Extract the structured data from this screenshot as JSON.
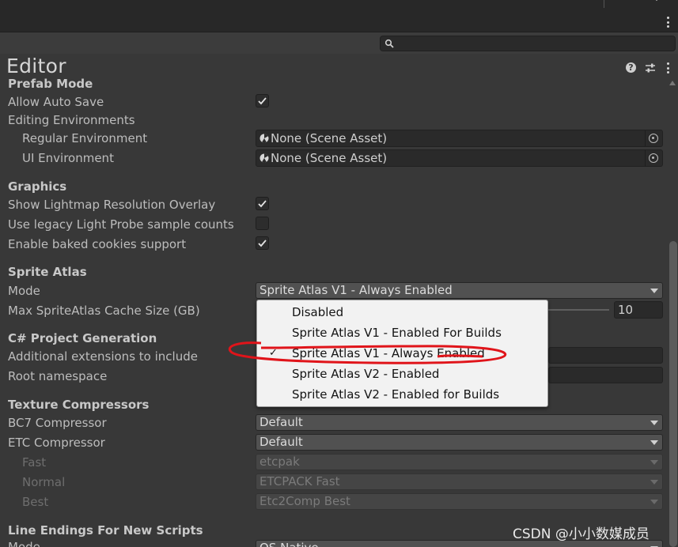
{
  "window": {
    "title": "Editor"
  },
  "search": {
    "placeholder": ""
  },
  "icons": {
    "help": "help-icon",
    "presets": "presets-icon",
    "menu": "kebab-menu-icon",
    "search": "search-icon",
    "scene_asset": "scene-asset-icon",
    "object_picker": "object-picker-icon",
    "dropdown_arrow": "chevron-down-icon",
    "checkmark": "checkmark-icon"
  },
  "help_glyph": "?",
  "sections": {
    "prefab_mode": {
      "title": "Prefab Mode",
      "allow_auto_save": {
        "label": "Allow Auto Save",
        "checked": true
      },
      "editing_environments": "Editing Environments",
      "regular_environment": {
        "label": "Regular Environment",
        "value": "None (Scene Asset)"
      },
      "ui_environment": {
        "label": "UI Environment",
        "value": "None (Scene Asset)"
      }
    },
    "graphics": {
      "title": "Graphics",
      "show_lightmap_overlay": {
        "label": "Show Lightmap Resolution Overlay",
        "checked": true
      },
      "legacy_light_probe": {
        "label": "Use legacy Light Probe sample counts",
        "checked": false
      },
      "baked_cookies": {
        "label": "Enable baked cookies support",
        "checked": true
      }
    },
    "sprite_atlas": {
      "title": "Sprite Atlas",
      "mode": {
        "label": "Mode",
        "value": "Sprite Atlas V1 - Always Enabled"
      },
      "max_cache": {
        "label": "Max SpriteAtlas Cache Size (GB)",
        "value": "10"
      },
      "mode_options": [
        {
          "label": "Disabled",
          "selected": false
        },
        {
          "label": "Sprite Atlas V1 - Enabled For Builds",
          "selected": false
        },
        {
          "label": "Sprite Atlas V1 - Always Enabled",
          "selected": true
        },
        {
          "label": "Sprite Atlas V2 - Enabled",
          "selected": false
        },
        {
          "label": "Sprite Atlas V2 - Enabled for Builds",
          "selected": false
        }
      ],
      "check_glyph": "✓"
    },
    "csharp_project": {
      "title": "C# Project Generation",
      "additional_extensions": {
        "label": "Additional extensions to include",
        "value": ""
      },
      "root_namespace": {
        "label": "Root namespace",
        "value": ""
      }
    },
    "texture_compressors": {
      "title": "Texture Compressors",
      "bc7": {
        "label": "BC7 Compressor",
        "value": "Default"
      },
      "etc": {
        "label": "ETC Compressor",
        "value": "Default"
      },
      "fast": {
        "label": "Fast",
        "value": "etcpak"
      },
      "normal": {
        "label": "Normal",
        "value": "ETCPACK Fast"
      },
      "best": {
        "label": "Best",
        "value": "Etc2Comp Best"
      }
    },
    "line_endings": {
      "title": "Line Endings For New Scripts",
      "mode": {
        "label": "Mode",
        "value": "OS Native"
      }
    }
  },
  "annotation_color": "#e0141a",
  "watermark": "CSDN @小小数媒成员"
}
